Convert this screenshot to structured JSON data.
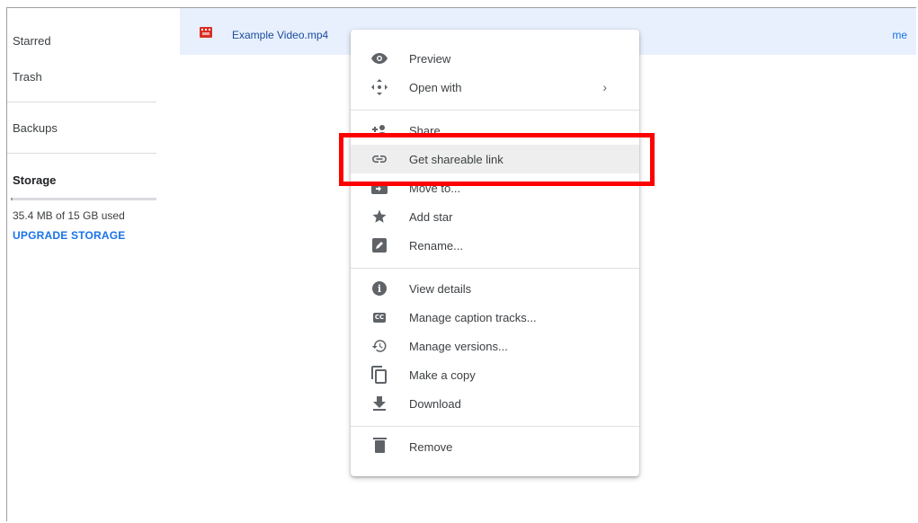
{
  "sidebar": {
    "starred": "Starred",
    "trash": "Trash",
    "backups": "Backups",
    "storage_label": "Storage",
    "storage_used": "35.4 MB of 15 GB used",
    "upgrade": "UPGRADE STORAGE",
    "storage_fraction": 0.0023
  },
  "file": {
    "name": "Example Video.mp4",
    "owner": "me"
  },
  "menu": {
    "items": [
      {
        "label": "Preview",
        "icon": "eye-icon"
      },
      {
        "label": "Open with",
        "icon": "move-arrows-icon",
        "submenu": true
      },
      {
        "label": "Share",
        "icon": "person-add-icon"
      },
      {
        "label": "Get shareable link",
        "icon": "link-icon",
        "highlighted": true
      },
      {
        "label": "Move to...",
        "icon": "folder-move-icon"
      },
      {
        "label": "Add star",
        "icon": "star-icon"
      },
      {
        "label": "Rename...",
        "icon": "edit-icon"
      },
      {
        "label": "View details",
        "icon": "info-icon"
      },
      {
        "label": "Manage caption tracks...",
        "icon": "closed-caption-icon"
      },
      {
        "label": "Manage versions...",
        "icon": "history-icon"
      },
      {
        "label": "Make a copy",
        "icon": "copy-icon"
      },
      {
        "label": "Download",
        "icon": "download-icon"
      },
      {
        "label": "Remove",
        "icon": "trash-icon"
      }
    ],
    "chevron": "›"
  },
  "colors": {
    "selected_row": "#e8f0fe",
    "link_blue": "#1a73e8",
    "annotation_red": "#ff0000",
    "menu_highlight": "#eeeeee"
  }
}
